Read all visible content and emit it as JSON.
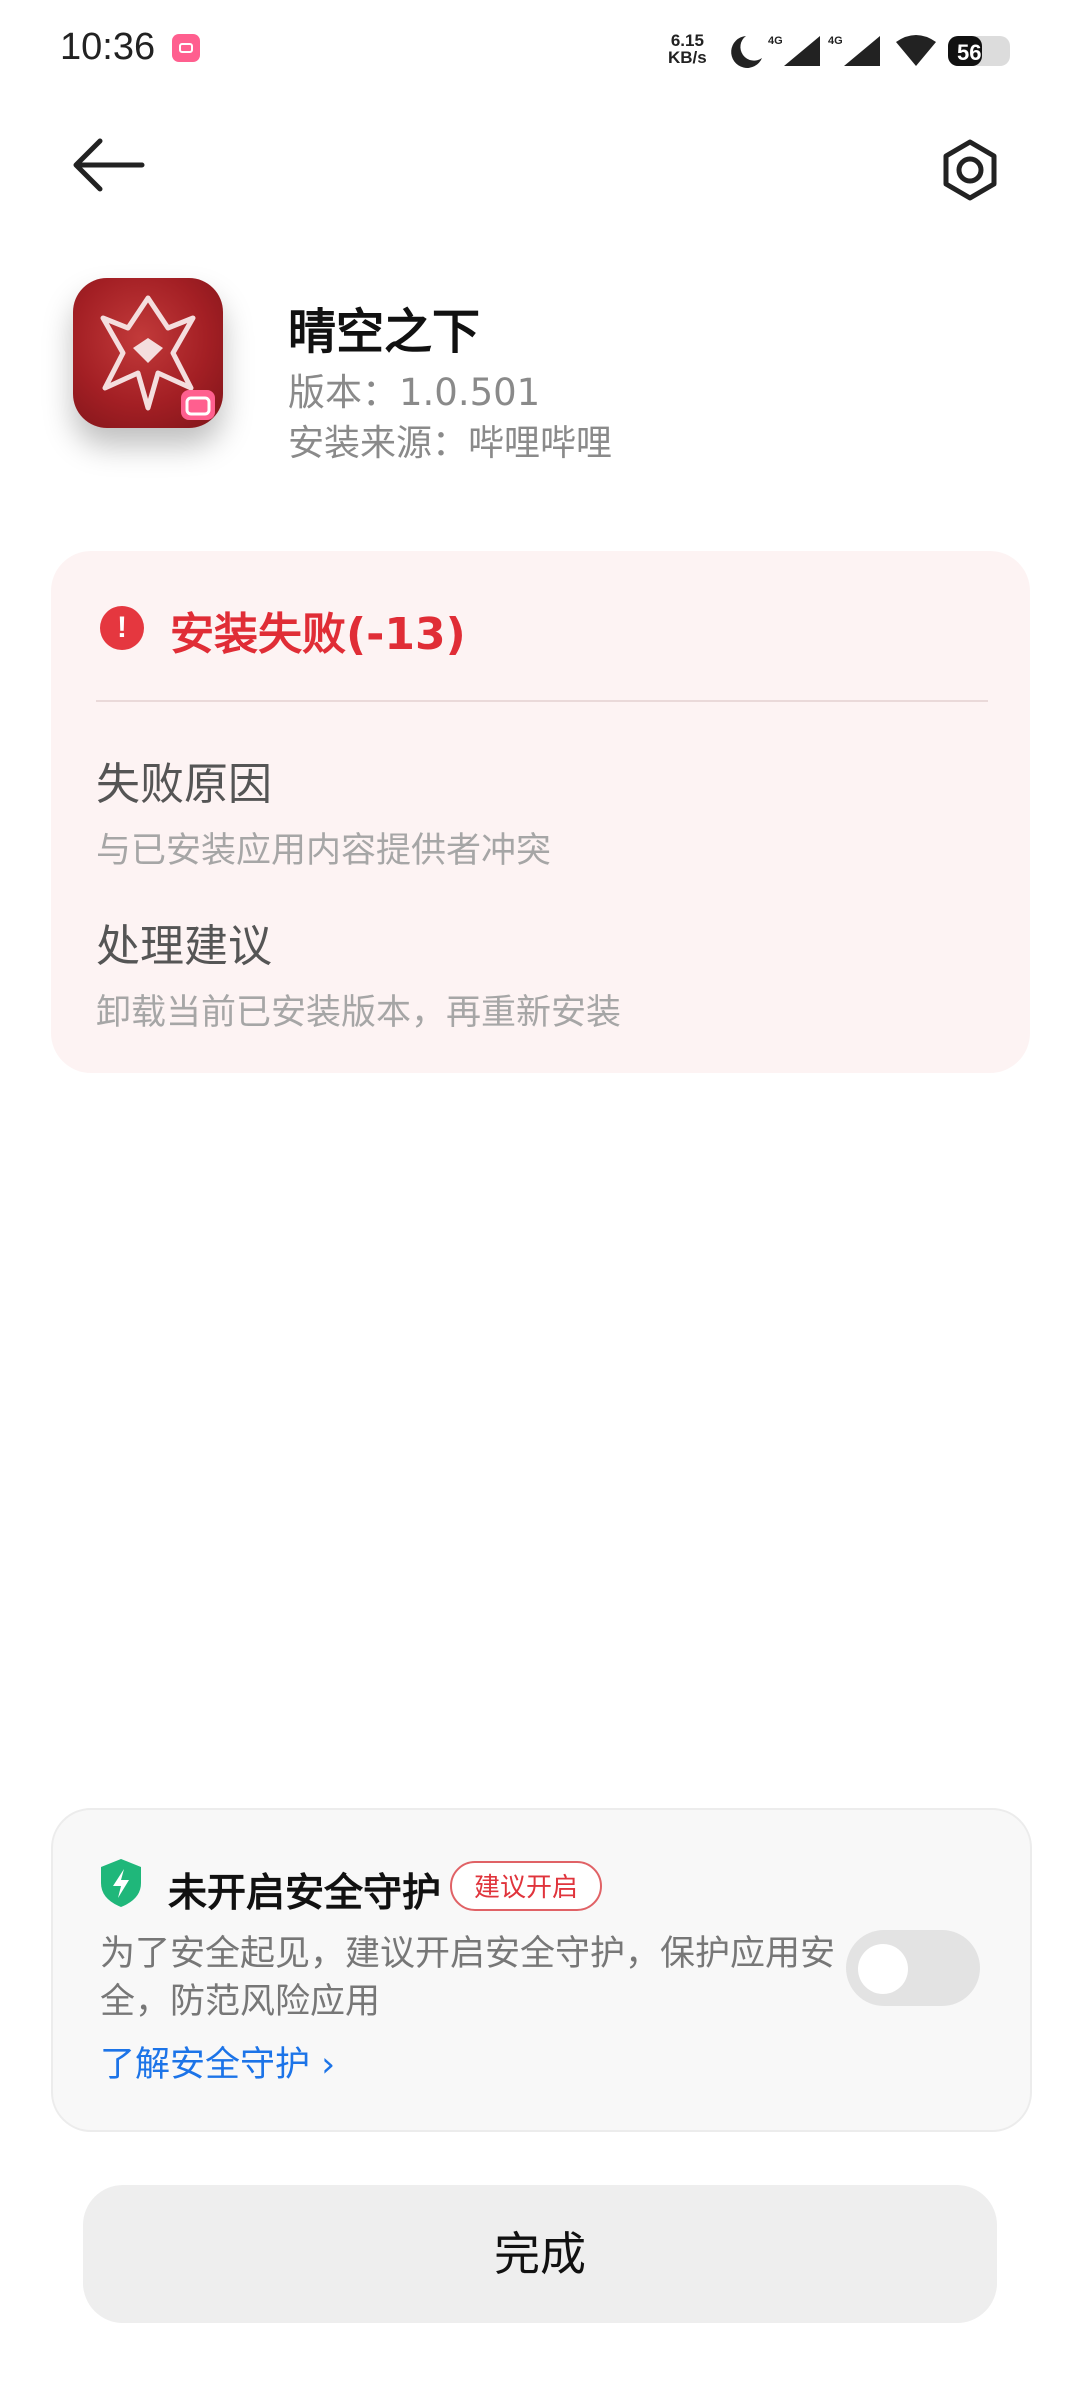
{
  "status_bar": {
    "time": "10:36",
    "net_speed_value": "6.15",
    "net_speed_unit": "KB/s",
    "signal_1_label": "4G",
    "signal_2_label": "4G",
    "battery": "56"
  },
  "header": {
    "back_icon": "back-arrow-icon",
    "settings_icon": "gear-icon"
  },
  "app": {
    "name": "晴空之下",
    "version": "版本：1.0.501",
    "source": "安装来源：哔哩哔哩"
  },
  "error": {
    "title": "安装失败(-13)",
    "reason_title": "失败原因",
    "reason_text": "与已安装应用内容提供者冲突",
    "advice_title": "处理建议",
    "advice_text": "卸载当前已安装版本，再重新安装",
    "accent_color": "#e02d36"
  },
  "security": {
    "title": "未开启安全守护",
    "badge": "建议开启",
    "description": "为了安全起见，建议开启安全守护，保护应用安全，防范风险应用",
    "link": "了解安全守护 ›",
    "toggle_on": false
  },
  "footer": {
    "done_label": "完成"
  }
}
